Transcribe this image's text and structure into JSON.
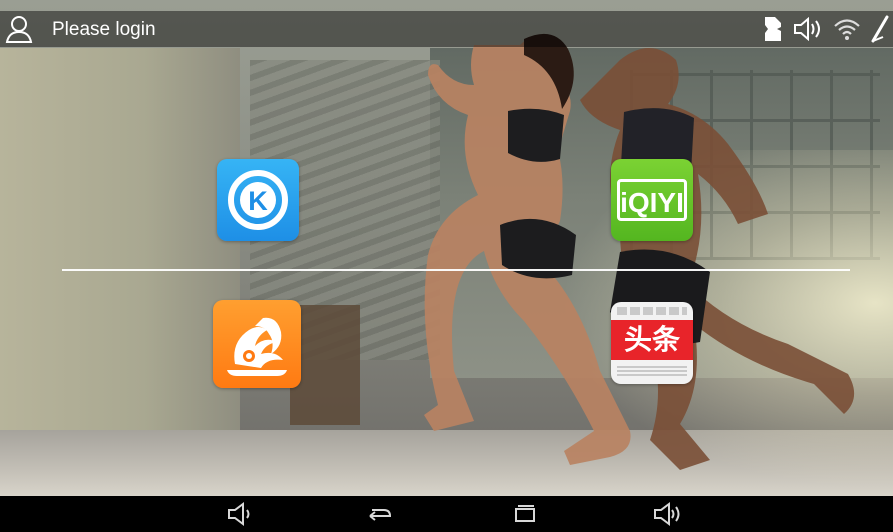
{
  "status_bar": {
    "login_text": "Please login",
    "icons": [
      "user-icon",
      "notification-icon",
      "volume-icon",
      "wifi-icon",
      "signal-icon"
    ]
  },
  "apps": [
    {
      "name": "kugou",
      "icon": "kugou-app-icon",
      "glyph": "K",
      "color": "#1e8fe6"
    },
    {
      "name": "iqiyi",
      "icon": "iqiyi-app-icon",
      "glyph": "iQIYI",
      "color": "#54b620"
    },
    {
      "name": "uc-browser",
      "icon": "uc-browser-app-icon",
      "color": "#ff7a12"
    },
    {
      "name": "toutiao",
      "icon": "toutiao-app-icon",
      "glyph": "头条",
      "color": "#e8242a"
    }
  ],
  "nav_bar": {
    "buttons": [
      "volume-down-icon",
      "back-icon",
      "recent-apps-icon",
      "volume-up-icon"
    ]
  }
}
